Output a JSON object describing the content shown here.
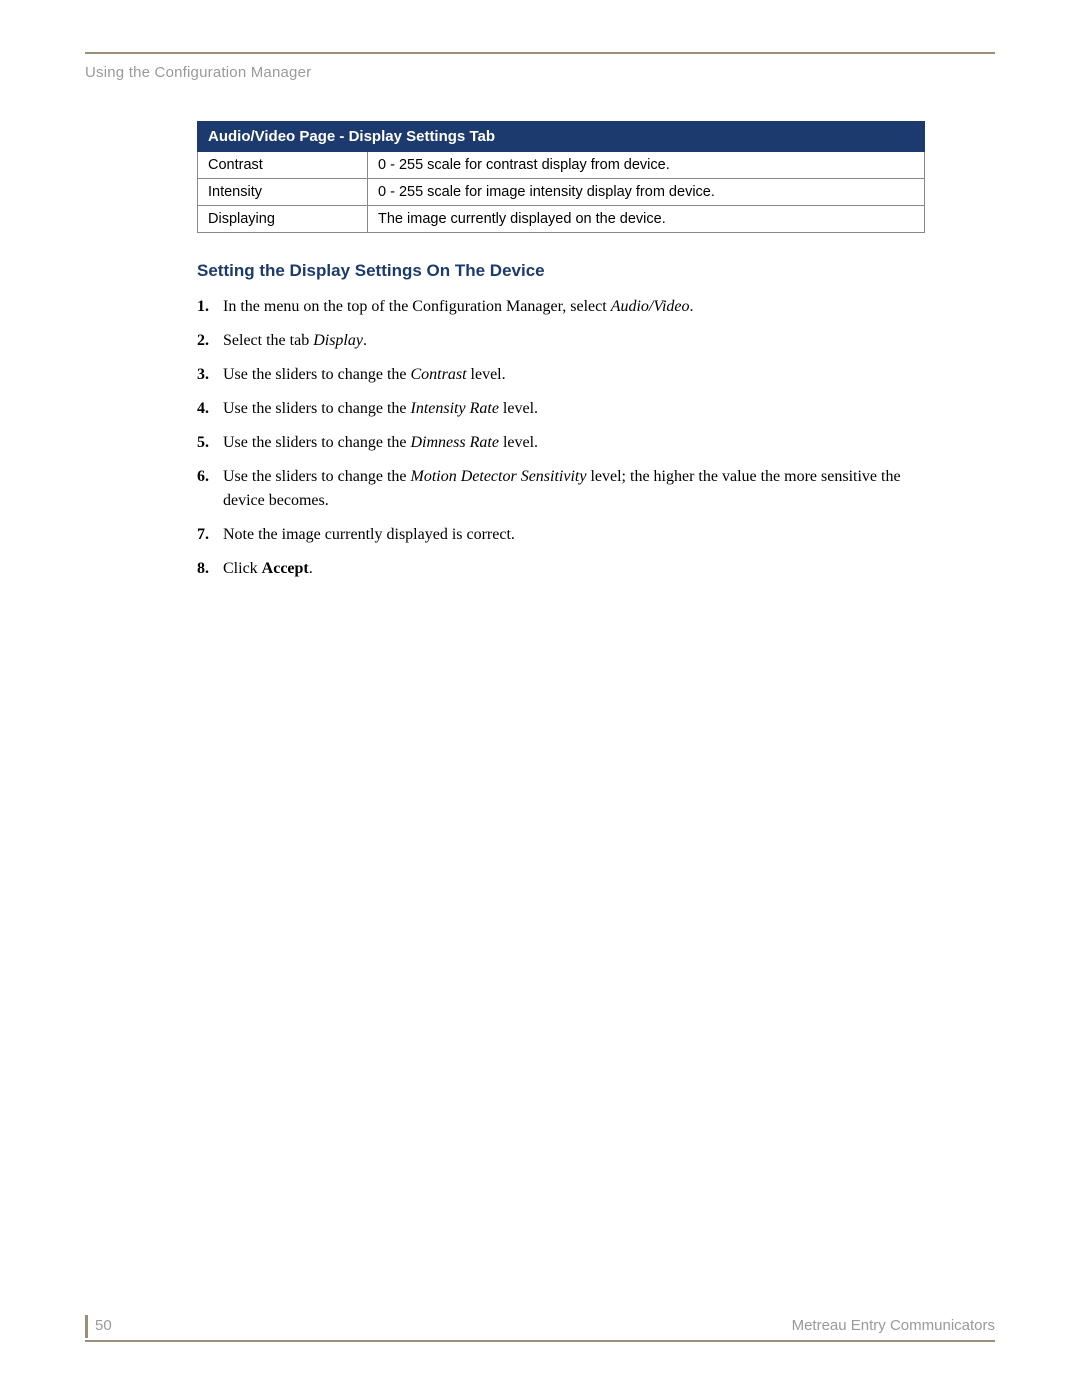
{
  "header": {
    "running": "Using the Configuration Manager"
  },
  "table": {
    "title": "Audio/Video Page - Display Settings Tab",
    "rows": [
      {
        "label": "Contrast",
        "desc": "0 - 255 scale for contrast display from device."
      },
      {
        "label": "Intensity",
        "desc": "0 - 255 scale for image intensity display from device."
      },
      {
        "label": "Displaying",
        "desc": "The image currently displayed on the device."
      }
    ]
  },
  "section": {
    "heading": "Setting the Display Settings On The Device",
    "steps": [
      {
        "pre": "In the menu on the top of the Configuration Manager, select ",
        "em": "Audio/Video",
        "post": "."
      },
      {
        "pre": "Select the tab ",
        "em": "Display",
        "post": "."
      },
      {
        "pre": "Use the sliders to change the ",
        "em": "Contrast",
        "post": " level."
      },
      {
        "pre": "Use the sliders to change the ",
        "em": "Intensity Rate",
        "post": " level."
      },
      {
        "pre": "Use the sliders to change the ",
        "em": "Dimness Rate",
        "post": " level."
      },
      {
        "pre": "Use the sliders to change the ",
        "em": "Motion Detector Sensitivity",
        "post": " level; the higher the value the more sensitive the device becomes."
      },
      {
        "pre": "Note the image currently displayed is correct.",
        "em": "",
        "post": ""
      },
      {
        "pre": "Click ",
        "strong": "Accept",
        "post": "."
      }
    ]
  },
  "footer": {
    "page": "50",
    "title": "Metreau Entry Communicators"
  }
}
